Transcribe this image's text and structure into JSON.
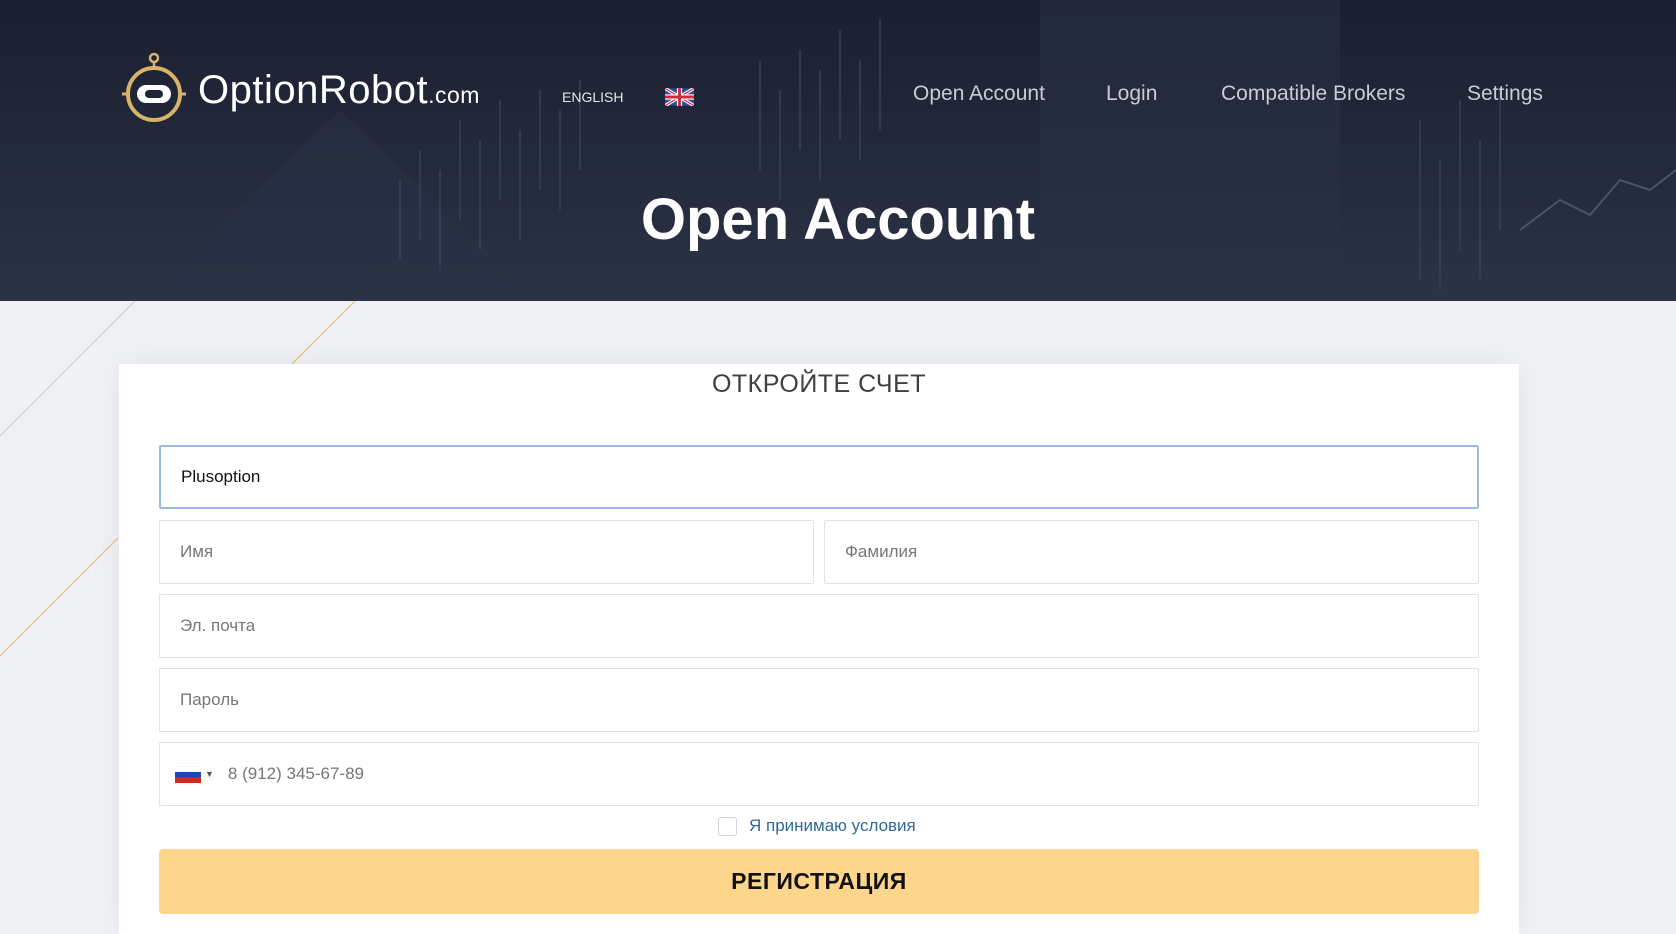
{
  "brand": {
    "name": "OptionRobot",
    "tld": ".com"
  },
  "language": {
    "label": "ENGLISH",
    "flag_icon": "uk-flag-icon"
  },
  "nav": [
    {
      "label": "Open Account"
    },
    {
      "label": "Login"
    },
    {
      "label": "Compatible Brokers"
    },
    {
      "label": "Settings"
    }
  ],
  "page_title": "Open Account",
  "form": {
    "title": "ОТКРОЙТЕ СЧЕТ",
    "broker": {
      "value": "Plusoption"
    },
    "first_name": {
      "placeholder": "Имя"
    },
    "last_name": {
      "placeholder": "Фамилия"
    },
    "email": {
      "placeholder": "Эл. почта"
    },
    "password": {
      "placeholder": "Пароль"
    },
    "phone": {
      "placeholder": "8 (912) 345-67-89",
      "country_icon": "russia-flag-icon"
    },
    "terms": {
      "label": "Я принимаю условия",
      "checked": false
    },
    "submit_label": "РЕГИСТРАЦИЯ"
  },
  "colors": {
    "header_bg": "#1f2536",
    "accent": "#fdd68b",
    "active_border": "#9bbbe0",
    "link": "#2f6b9a"
  }
}
